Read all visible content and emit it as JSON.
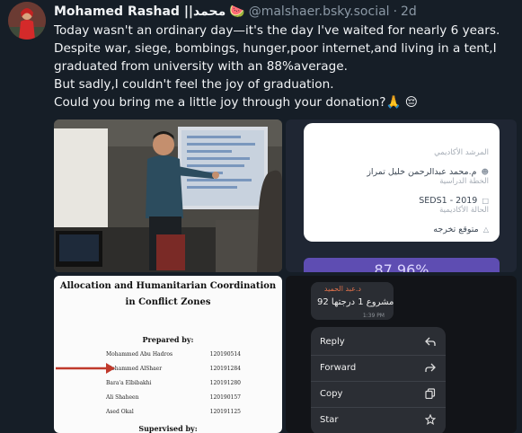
{
  "post": {
    "author_name": "Mohamed Rashad ||محمد",
    "author_emoji": "🍉",
    "handle": "@malshaer.bsky.social",
    "separator": "·",
    "time": "2d",
    "lines": [
      "Today wasn't an ordinary day—it's the day I've waited for nearly 6 years.",
      "Despite war, siege, bombings, hunger,poor internet,and living in a tent,I",
      "graduated from university with an 88%average.",
      "But sadly,I couldn't feel the joy of graduation.",
      "Could you bring me a little joy through your donation?🙏 😔"
    ]
  },
  "images": {
    "transcript": {
      "advisor_label": "المرشد الأكاديمي",
      "advisor_value": "م.محمد عبدالرحمن خليل تمراز",
      "plan_label": "الخطة الدراسية",
      "plan_value": "SEDS1 - 2019",
      "status_label": "الحالة الأكاديمية",
      "status_value": "متوقع تخرجه",
      "average_fragment": "87.96%"
    },
    "document": {
      "title_line1": "Allocation and Humanitarian Coordination",
      "title_line2": "in Conflict Zones",
      "prepared_by": "Prepared by:",
      "students": [
        {
          "name": "Mohammed Abu Hadros",
          "id": "120190514"
        },
        {
          "name": "Mohammed AlShaer",
          "id": "120191284"
        },
        {
          "name": "Bara'a Elbibakhi",
          "id": "120191280"
        },
        {
          "name": "Ali Shaheen",
          "id": "120190157"
        },
        {
          "name": "Ased Okal",
          "id": "120191125"
        }
      ],
      "supervised_by": "Supervised by:"
    },
    "chat": {
      "sender": "د.عبد الحميد",
      "message": "مشروع 1 درجتها 92",
      "time": "1:39 PM",
      "menu": [
        "Reply",
        "Forward",
        "Copy",
        "Star"
      ]
    }
  },
  "colors": {
    "background": "#161e27",
    "text": "#f1f3f5",
    "muted": "#8b98a5",
    "accent_purple": "#5e4db2",
    "arrow_red": "#c0392b"
  }
}
